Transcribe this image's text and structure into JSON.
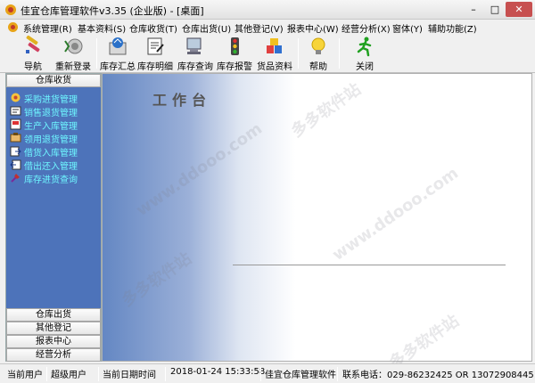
{
  "window": {
    "title": "佳宜仓库管理软件v3.35 (企业版) - [桌面]",
    "min": "–",
    "max": "□",
    "close": "✕"
  },
  "menu": [
    {
      "id": "sys",
      "label": "系统管理(R)"
    },
    {
      "id": "basic",
      "label": "基本资料(S)"
    },
    {
      "id": "in",
      "label": "仓库收货(T)"
    },
    {
      "id": "out",
      "label": "仓库出货(U)"
    },
    {
      "id": "other",
      "label": "其他登记(V)"
    },
    {
      "id": "report",
      "label": "报表中心(W)"
    },
    {
      "id": "analysis",
      "label": "经营分析(X)"
    },
    {
      "id": "window",
      "label": "窗体(Y)"
    },
    {
      "id": "help",
      "label": "辅助功能(Z)"
    }
  ],
  "toolbar": [
    {
      "id": "nav",
      "label": "导航",
      "icon": "navigation-icon"
    },
    {
      "id": "relogin",
      "label": "重新登录",
      "icon": "relogin-icon"
    },
    {
      "id": "summary",
      "label": "库存汇总",
      "icon": "inventory-summary-icon"
    },
    {
      "id": "detail",
      "label": "库存明细",
      "icon": "inventory-detail-icon"
    },
    {
      "id": "query",
      "label": "库存查询",
      "icon": "inventory-query-icon"
    },
    {
      "id": "alarm",
      "label": "库存报警",
      "icon": "traffic-light-icon"
    },
    {
      "id": "goods",
      "label": "货品资料",
      "icon": "goods-boxes-icon"
    },
    {
      "id": "help",
      "label": "帮助",
      "icon": "lightbulb-icon"
    },
    {
      "id": "close",
      "label": "关闭",
      "icon": "running-man-icon"
    }
  ],
  "left_panel": {
    "top_section": "仓库收货",
    "items": [
      {
        "label": "采购进货管理",
        "icon": "purchase-icon"
      },
      {
        "label": "销售退货管理",
        "icon": "sales-return-icon"
      },
      {
        "label": "生产入库管理",
        "icon": "production-icon"
      },
      {
        "label": "领用退货管理",
        "icon": "requisition-return-icon"
      },
      {
        "label": "借货入库管理",
        "icon": "borrow-in-icon"
      },
      {
        "label": "借出还入管理",
        "icon": "lend-return-icon"
      },
      {
        "label": "库存进货查询",
        "icon": "stock-query-icon"
      }
    ],
    "bottom_sections": [
      "仓库出货",
      "其他登记",
      "报表中心",
      "经营分析"
    ]
  },
  "workspace": {
    "title": "工作台"
  },
  "watermarks": [
    "多多软件站",
    "www.ddooo.com",
    "www.ddooo.com",
    "多多软件站",
    "多多软件站"
  ],
  "statusbar": {
    "user_label": "当前用户",
    "user_value": "超级用户",
    "date_label": "当前日期时间",
    "date_value": "2018-01-24 15:33:58",
    "product": "佳宜仓库管理软件",
    "contact": "联系电话：029-86232425  OR  13072908445"
  }
}
